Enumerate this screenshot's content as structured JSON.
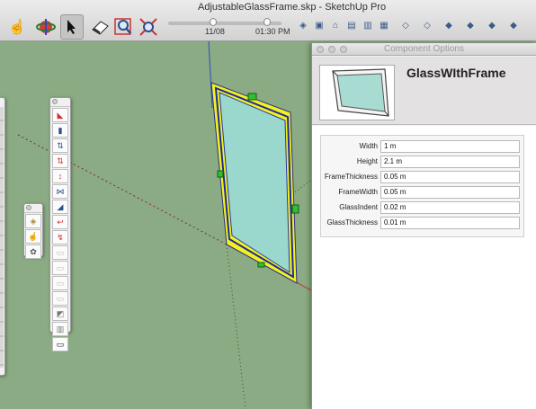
{
  "window": {
    "title": "AdjustableGlassFrame.skp - SketchUp Pro"
  },
  "toolbar": {
    "shadow_time": {
      "date": "11/08",
      "time": "01:30 PM"
    },
    "tools": [
      {
        "name": "hand-icon",
        "glyph": "☝"
      },
      {
        "name": "orbit-icon",
        "glyph": "◉"
      },
      {
        "name": "select-arrow-icon",
        "glyph": "➚"
      },
      {
        "name": "eraser-icon",
        "glyph": "▰"
      },
      {
        "name": "zoom-window-icon",
        "glyph": "⊠"
      },
      {
        "name": "zoom-extents-icon",
        "glyph": "⤢"
      }
    ]
  },
  "component_options": {
    "window_title": "Component Options",
    "name": "GlassWIthFrame",
    "attributes": [
      {
        "label": "Width",
        "value": "1 m"
      },
      {
        "label": "Height",
        "value": "2.1 m"
      },
      {
        "label": "FrameThickness",
        "value": "0.05 m"
      },
      {
        "label": "FrameWidth",
        "value": "0.05 m"
      },
      {
        "label": "GlassIndent",
        "value": "0.02 m"
      },
      {
        "label": "GlassThickness",
        "value": "0.01 m"
      }
    ]
  },
  "colors": {
    "ground": "#8aab83",
    "glass": "#9ad7cc",
    "frame_highlight": "#f2f21e",
    "axis_red": "#d23c3c",
    "axis_blue": "#3046c8"
  }
}
